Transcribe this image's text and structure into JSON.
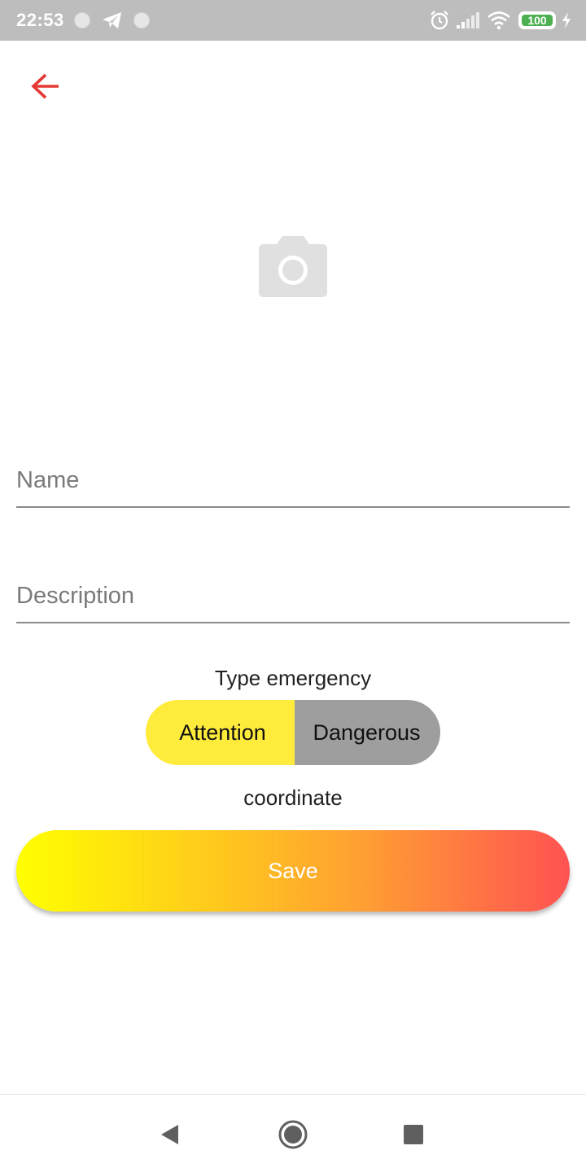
{
  "status_bar": {
    "time": "22:53",
    "battery_level": "100",
    "icons": [
      "notification-dot-icon",
      "telegram-icon",
      "notification-dot-icon",
      "alarm-icon",
      "signal-icon",
      "wifi-icon",
      "battery-icon",
      "charging-icon"
    ]
  },
  "header": {
    "back_icon": "arrow-left-icon"
  },
  "photo": {
    "icon": "camera-icon"
  },
  "form": {
    "name_placeholder": "Name",
    "name_value": "",
    "description_placeholder": "Description",
    "description_value": ""
  },
  "emergency": {
    "label": "Type emergency",
    "options": [
      "Attention",
      "Dangerous"
    ],
    "selected": "Attention"
  },
  "coordinate": {
    "label": "coordinate"
  },
  "save": {
    "label": "Save"
  },
  "nav_bar": {
    "icons": [
      "back-triangle-icon",
      "home-circle-icon",
      "recents-square-icon"
    ]
  },
  "colors": {
    "status_bar": "#bdbdbd",
    "back_arrow": "#e53935",
    "camera_icon": "#e0e0e0",
    "attention": "#ffeb3b",
    "dangerous": "#9e9e9e",
    "save_gradient_start": "#ffff00",
    "save_gradient_end": "#ff5252",
    "battery": "#4caf50"
  }
}
